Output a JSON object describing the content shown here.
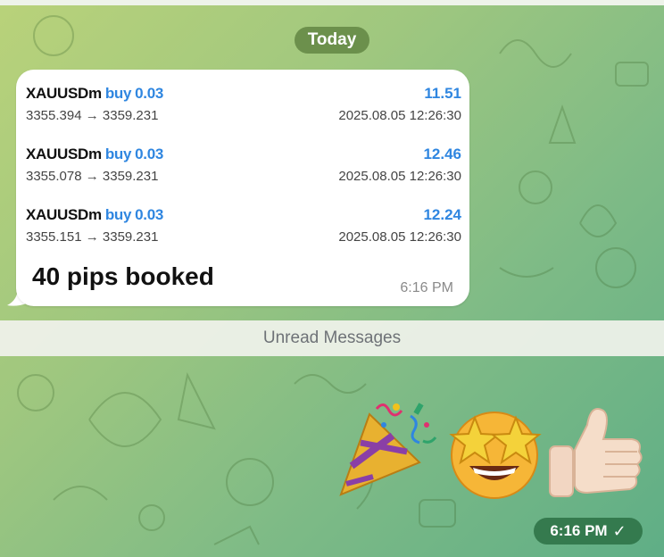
{
  "date_divider": "Today",
  "message": {
    "trades": [
      {
        "symbol": "XAUUSDm",
        "side": "buy",
        "lot": "0.03",
        "profit": "11.51",
        "prices": "3355.394 → 3359.231",
        "time": "2025.08.05 12:26:30"
      },
      {
        "symbol": "XAUUSDm",
        "side": "buy",
        "lot": "0.03",
        "profit": "12.46",
        "prices": "3355.078 → 3359.231",
        "time": "2025.08.05 12:26:30"
      },
      {
        "symbol": "XAUUSDm",
        "side": "buy",
        "lot": "0.03",
        "profit": "12.24",
        "prices": "3355.151 → 3359.231",
        "time": "2025.08.05 12:26:30"
      }
    ],
    "text": "40 pips booked",
    "time": "6:16 PM"
  },
  "unread_divider": "Unread Messages",
  "sent_message": {
    "emojis": [
      "party-popper",
      "star-struck",
      "thumbs-up"
    ],
    "time": "6:16 PM",
    "status_icon": "read-check-icon"
  },
  "colors": {
    "accent_blue": "#2f86e0",
    "sent_pill": "#2a6e42",
    "date_pill": "#5c803e"
  }
}
